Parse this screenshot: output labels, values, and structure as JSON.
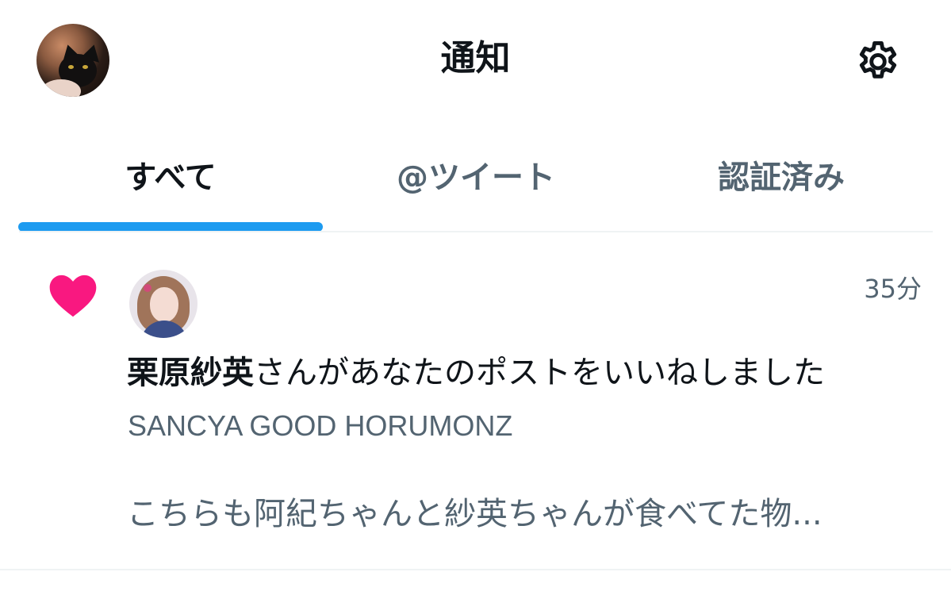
{
  "header": {
    "title": "通知",
    "settings_icon": "gear-icon",
    "avatar_icon": "profile-avatar"
  },
  "tabs": [
    {
      "label": "すべて",
      "selected": true
    },
    {
      "label": "@ツイート",
      "selected": false
    },
    {
      "label": "認証済み",
      "selected": false
    }
  ],
  "colors": {
    "accent": "#1d9bf0",
    "like": "#f91880",
    "text_primary": "#0f1419",
    "text_secondary": "#536471"
  },
  "notification": {
    "type_icon": "heart-icon",
    "time": "35分",
    "user_name": "栗原紗英",
    "action_text": "さんがあなたのポストをいいねしました",
    "account_line": "SANCYA GOOD HORUMONZ",
    "preview": "こちらも阿紀ちゃんと紗英ちゃんが食べてた物..."
  }
}
